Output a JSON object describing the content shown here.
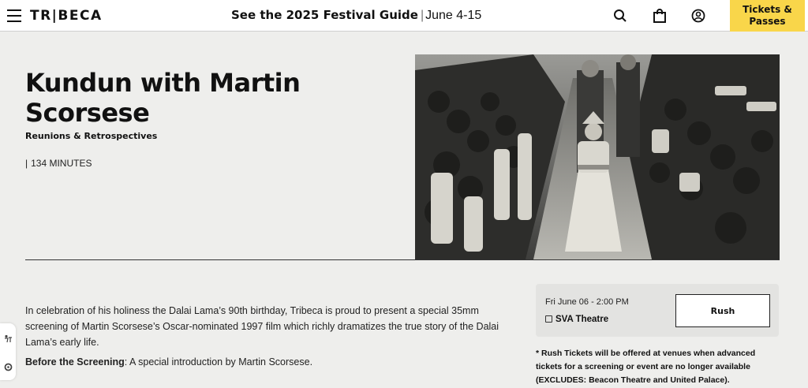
{
  "header": {
    "logo_text": "TR|BECA",
    "promo_bold": "See the 2025 Festival Guide",
    "promo_separator": "|",
    "promo_dates": "June 4-15",
    "tickets_line1": "Tickets &",
    "tickets_line2": "Passes",
    "icons": [
      "menu-icon",
      "search-icon",
      "bag-icon",
      "account-icon"
    ],
    "accent_color": "#f9d64a"
  },
  "film": {
    "title": "Kundun with Martin Scorsese",
    "category": "Reunions & Retrospectives",
    "runtime_bar": "|",
    "runtime": "134 MINUTES"
  },
  "description": {
    "text": "In celebration of his holiness the Dalai Lama’s 90th birthday, Tribeca is proud to present a special 35mm screening of Martin Scorsese’s Oscar-nominated 1997 film which richly dramatizes the true story of the Dalai Lama’s early life.",
    "before_label": "Before the Screening",
    "before_text": ": A special introduction by Martin Scorsese."
  },
  "screening": {
    "date_time": "Fri June 06 - 2:00 PM",
    "venue": "SVA Theatre",
    "button_label": "Rush",
    "note": "* Rush Tickets will be offered at venues when advanced tickets for a screening or event are no longer available (EXCLUDES: Beacon Theatre and United Palace)."
  },
  "side_widget": {
    "icons": [
      "accessibility-icon",
      "settings-icon"
    ]
  }
}
